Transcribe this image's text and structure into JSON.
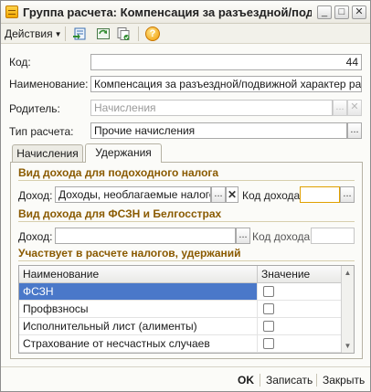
{
  "window": {
    "title": "Группа расчета: Компенсация за разъездной/подв...",
    "controls": {
      "minimize": "_",
      "maximize": "□",
      "close": "✕"
    }
  },
  "toolbar": {
    "actions_label": "Действия",
    "icons": [
      "form-to-list-icon",
      "refresh-icon",
      "copy-icon",
      "help-icon"
    ],
    "help_glyph": "?"
  },
  "form": {
    "code": {
      "label": "Код:",
      "value": "44"
    },
    "name": {
      "label": "Наименование:",
      "value": "Компенсация за разъездной/подвижной характер работ"
    },
    "parent": {
      "label": "Родитель:",
      "value": "Начисления"
    },
    "calc_type": {
      "label": "Тип расчета:",
      "value": "Прочие начисления"
    }
  },
  "tabs": [
    {
      "label": "Начисления",
      "active": false
    },
    {
      "label": "Удержания",
      "active": true
    }
  ],
  "income_tax_group": {
    "title": "Вид дохода для подоходного налога",
    "income_label": "Доход:",
    "income_value": "Доходы, необлагаемые налогом",
    "code_label": "Код дохода:",
    "code_value": ""
  },
  "fszn_group": {
    "title": "Вид дохода для ФСЗН и Белгосстрах",
    "income_label": "Доход:",
    "income_value": "",
    "code_label": "Код дохода:",
    "code_value": ""
  },
  "participation": {
    "title": "Участвует в расчете налогов, удержаний",
    "columns": [
      "Наименование",
      "Значение"
    ],
    "rows": [
      {
        "name": "ФСЗН",
        "checked": false,
        "selected": true
      },
      {
        "name": "Профвзносы",
        "checked": false,
        "selected": false
      },
      {
        "name": "Исполнительный лист (алименты)",
        "checked": false,
        "selected": false
      },
      {
        "name": "Страхование от несчастных случаев",
        "checked": false,
        "selected": false
      }
    ]
  },
  "buttons": {
    "dots": "...",
    "clear": "✕",
    "ok": "OK",
    "save": "Записать",
    "close": "Закрыть"
  },
  "colors": {
    "group_title": "#8a5a00",
    "selection": "#4a78c9",
    "accent": "#f3a800"
  }
}
